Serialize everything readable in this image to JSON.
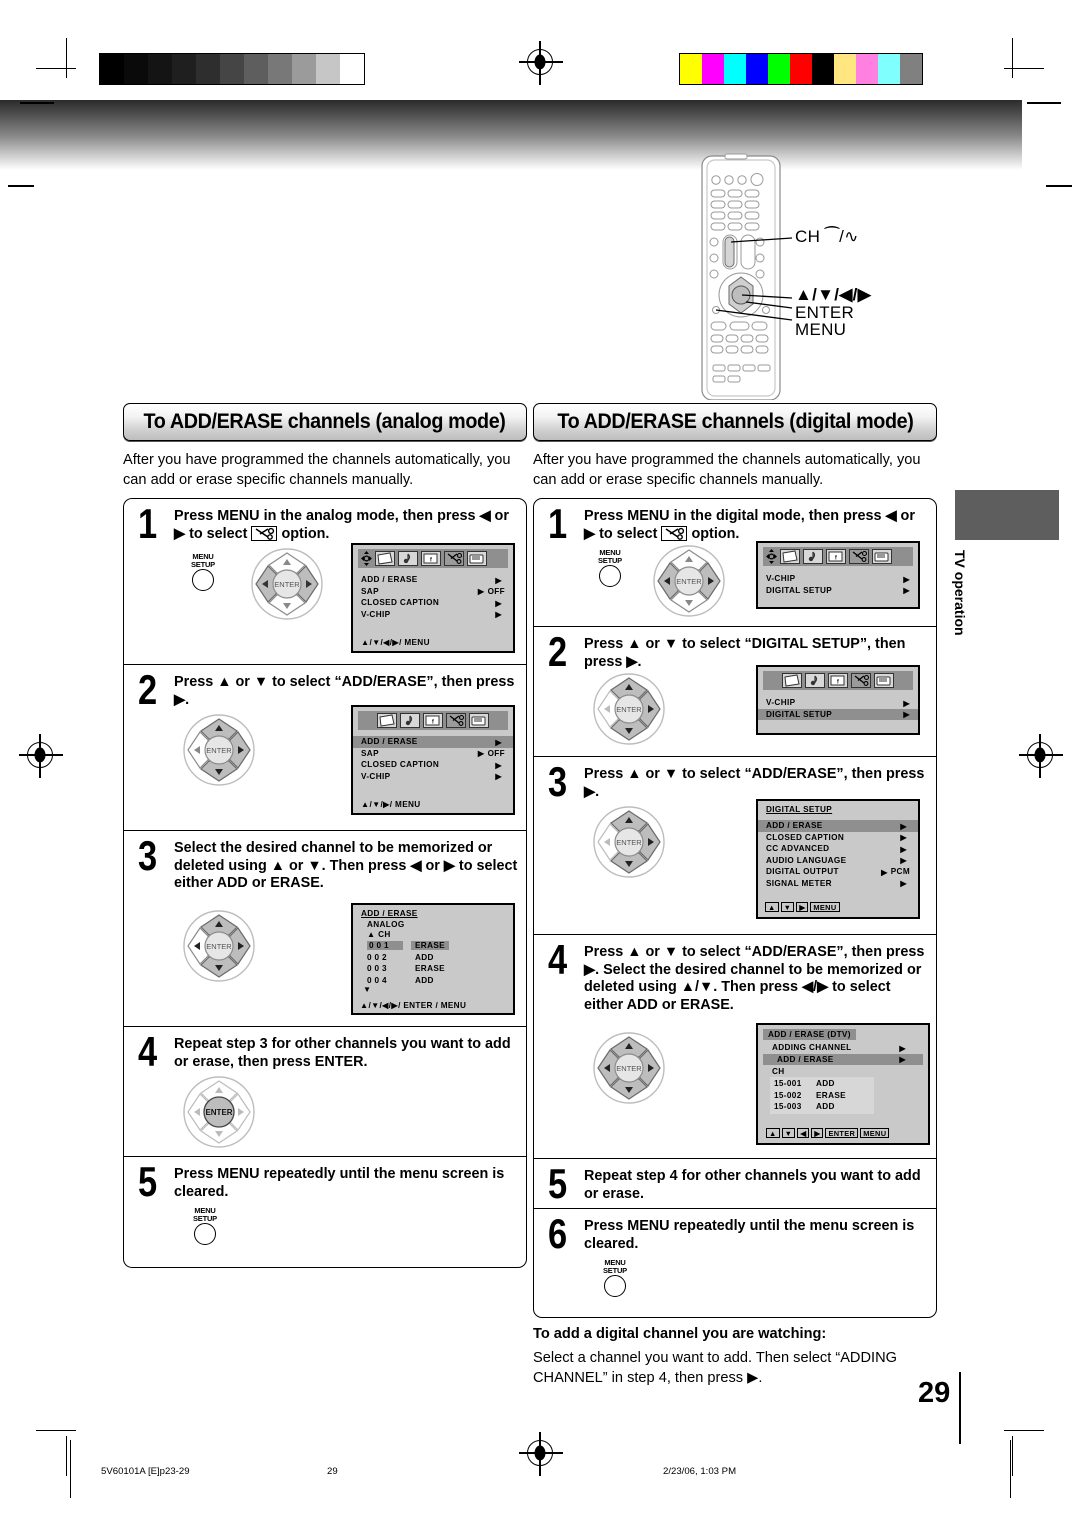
{
  "calibration": {
    "grayscale_steps": [
      "#000000",
      "#0a0a0a",
      "#141414",
      "#1f1f1f",
      "#2e2e2e",
      "#454545",
      "#5e5e5e",
      "#787878",
      "#9b9b9b",
      "#c6c6c6",
      "#ffffff"
    ],
    "color_steps": [
      "#ffff00",
      "#ff00ff",
      "#00ffff",
      "#0000ff",
      "#00ff00",
      "#ff0000",
      "#000000",
      "#ffe680",
      "#ff80e0",
      "#80ffff",
      "#808080"
    ]
  },
  "remote_callouts": [
    {
      "id": "ch-updown",
      "label": "CH ⁀/∿"
    },
    {
      "id": "arrow-keys",
      "label": "▲/▼/◀/▶"
    },
    {
      "id": "enter",
      "label": "ENTER"
    },
    {
      "id": "menu",
      "label": "MENU"
    }
  ],
  "analog": {
    "banner": "To ADD/ERASE channels (analog mode)",
    "intro": "After you have programmed the channels automatically, you can add or erase specific channels manually.",
    "steps": [
      {
        "num": "1",
        "text": "Press MENU in the analog mode, then press ◀ or ▶ to select ✂ option.",
        "text_parts": [
          "Press MENU in the analog mode, then press ◀",
          "or ▶ to select",
          "option."
        ]
      },
      {
        "num": "2",
        "text": "Press ▲ or ▼ to select “ADD/ERASE”, then press ▶."
      },
      {
        "num": "3",
        "text": "Select the desired channel to be memorized or deleted using ▲ or ▼. Then press ◀ or ▶ to select either ADD or ERASE."
      },
      {
        "num": "4",
        "text": "Repeat step 3 for other channels you want to add or erase, then press ENTER."
      },
      {
        "num": "5",
        "text": "Press MENU repeatedly until the menu screen is cleared."
      }
    ],
    "osd_main": {
      "items": [
        {
          "label": "ADD / ERASE",
          "value": "",
          "highlighted": false
        },
        {
          "label": "SAP",
          "value": "OFF",
          "highlighted": false
        },
        {
          "label": "CLOSED CAPTION",
          "value": "",
          "highlighted": false
        },
        {
          "label": "V-CHIP",
          "value": "",
          "highlighted": false
        }
      ],
      "footer": "▲/▼/◀/▶/ MENU"
    },
    "osd_main_sel": {
      "items": [
        {
          "label": "ADD / ERASE",
          "value": "",
          "highlighted": true
        },
        {
          "label": "SAP",
          "value": "OFF",
          "highlighted": false
        },
        {
          "label": "CLOSED CAPTION",
          "value": "",
          "highlighted": false
        },
        {
          "label": "V-CHIP",
          "value": "",
          "highlighted": false
        }
      ],
      "footer": "▲/▼/▶/ MENU"
    },
    "osd_addlist": {
      "title": "ADD / ERASE",
      "subtitle": "ANALOG",
      "col_header": "▲ CH",
      "rows": [
        {
          "ch": "0 0 1",
          "action": "ERASE",
          "highlighted": true
        },
        {
          "ch": "0 0 2",
          "action": "ADD",
          "highlighted": false
        },
        {
          "ch": "0 0 3",
          "action": "ERASE",
          "highlighted": false
        },
        {
          "ch": "0 0 4",
          "action": "ADD",
          "highlighted": false
        }
      ],
      "more": "▼",
      "footer": "▲/▼/◀/▶/ ENTER / MENU"
    },
    "menu_setup_label": [
      "MENU",
      "SETUP"
    ],
    "enter_label": "ENTER"
  },
  "digital": {
    "banner": "To ADD/ERASE channels (digital mode)",
    "intro": "After you have programmed the channels automatically, you can add or erase specific channels manually.",
    "steps": [
      {
        "num": "1",
        "text": "Press MENU in the digital mode, then press ◀ or ▶ to select ✂ option."
      },
      {
        "num": "2",
        "text": "Press ▲ or ▼ to select “DIGITAL SETUP”, then press ▶."
      },
      {
        "num": "3",
        "text": "Press ▲ or ▼ to select “ADD/ERASE”, then press ▶."
      },
      {
        "num": "4",
        "text": "Press ▲ or ▼ to select “ADD/ERASE”, then press ▶. Select the desired channel to be memorized or deleted using ▲/▼. Then press ◀/▶ to select either ADD or ERASE."
      },
      {
        "num": "5",
        "text": "Repeat step 4 for other channels you want to add or erase."
      },
      {
        "num": "6",
        "text": "Press MENU repeatedly until the menu screen is cleared."
      }
    ],
    "osd_main": {
      "items": [
        {
          "label": "V-CHIP",
          "value": "",
          "highlighted": false
        },
        {
          "label": "DIGITAL SETUP",
          "value": "",
          "highlighted": false
        }
      ]
    },
    "osd_main_sel": {
      "items": [
        {
          "label": "V-CHIP",
          "value": "",
          "highlighted": false
        },
        {
          "label": "DIGITAL SETUP",
          "value": "",
          "highlighted": true
        }
      ]
    },
    "osd_digital_setup": {
      "title": "DIGITAL  SETUP",
      "items": [
        {
          "label": "ADD / ERASE",
          "value": "",
          "highlighted": true
        },
        {
          "label": "CLOSED CAPTION",
          "value": "",
          "highlighted": false
        },
        {
          "label": "CC ADVANCED",
          "value": "",
          "highlighted": false
        },
        {
          "label": "AUDIO LANGUAGE",
          "value": "",
          "highlighted": false
        },
        {
          "label": "DIGITAL OUTPUT",
          "value": "PCM",
          "highlighted": false
        },
        {
          "label": "SIGNAL METER",
          "value": "",
          "highlighted": false
        }
      ],
      "footer_keys": [
        "▲",
        "▼",
        "▶",
        "MENU"
      ]
    },
    "osd_dtv_list": {
      "title": "ADD / ERASE (DTV)",
      "items": [
        {
          "label": "ADDING CHANNEL",
          "highlighted": false
        },
        {
          "label": "ADD / ERASE",
          "highlighted": true
        }
      ],
      "col_header": "CH",
      "rows": [
        {
          "ch": "15-001",
          "action": "ADD"
        },
        {
          "ch": "15-002",
          "action": "ERASE"
        },
        {
          "ch": "15-003",
          "action": "ADD"
        }
      ],
      "footer_keys": [
        "▲",
        "▼",
        "◀",
        "▶",
        "ENTER",
        "MENU"
      ]
    },
    "note_head": "To add a digital channel you are watching:",
    "note_body": "Select a channel you want to add. Then select “ADDING CHANNEL” in step 4, then press ▶."
  },
  "side_tab": {
    "label": "TV operation"
  },
  "page_number": "29",
  "footer": {
    "file": "5V60101A [E]p23-29",
    "page": "29",
    "timestamp": "2/23/06, 1:03 PM"
  }
}
